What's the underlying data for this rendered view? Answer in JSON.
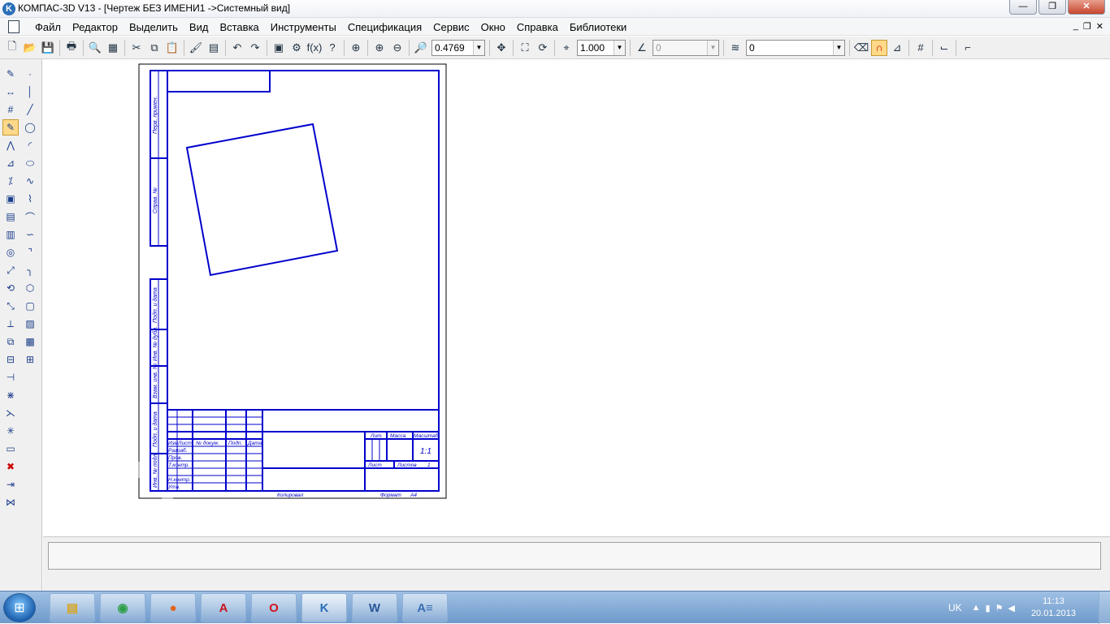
{
  "window": {
    "title": "КОМПАС-3D V13 - [Чертеж БЕЗ ИМЕНИ1 ->Системный вид]",
    "minimize": "—",
    "maximize": "❐",
    "close": "✕"
  },
  "menu": {
    "items": [
      "Файл",
      "Редактор",
      "Выделить",
      "Вид",
      "Вставка",
      "Инструменты",
      "Спецификация",
      "Сервис",
      "Окно",
      "Справка",
      "Библиотеки"
    ],
    "mdi_min": "_",
    "mdi_restore": "❐",
    "mdi_close": "✕"
  },
  "toolbar": {
    "zoom_value": "0.4769",
    "step_value": "1.000",
    "angle_value": "0",
    "layer_value": "0"
  },
  "drawing": {
    "title_block": {
      "col_izm": "Изм",
      "col_list": "Лист",
      "col_doc": "№ докум.",
      "col_podp": "Подп.",
      "col_data": "Дата",
      "razrab": "Разраб.",
      "prov": "Пров.",
      "tkontr": "Т.контр.",
      "nkontr": "Н.контр.",
      "utv": "Утв.",
      "lit": "Лит.",
      "massa": "Масса",
      "masshtab": "Масштаб",
      "scale_val": "1:1",
      "sheet": "Лист",
      "sheets": "Листов",
      "sheets_val": "1",
      "copied": "Копировал",
      "format": "Формат",
      "format_val": "A4"
    },
    "side_labels": [
      "Перв. примен.",
      "Справ. №",
      "Подп. и дата",
      "Инв. № дубл.",
      "Взам. инв. №",
      "Подп. и дата",
      "Инв. № подл."
    ]
  },
  "taskbar": {
    "start": "⊞",
    "apps": [
      {
        "name": "explorer",
        "glyph": "▤",
        "color": "#d9a520"
      },
      {
        "name": "chrome",
        "glyph": "◉",
        "color": "#2e9e48"
      },
      {
        "name": "firefox",
        "glyph": "●",
        "color": "#e2661c"
      },
      {
        "name": "acrobat",
        "glyph": "A",
        "color": "#c8161e"
      },
      {
        "name": "opera",
        "glyph": "O",
        "color": "#d4141d"
      },
      {
        "name": "kompas",
        "glyph": "K",
        "color": "#2a6fb8"
      },
      {
        "name": "word",
        "glyph": "W",
        "color": "#2b579a"
      },
      {
        "name": "notepad",
        "glyph": "A≡",
        "color": "#3a6eb5"
      }
    ],
    "lang": "UK",
    "time": "11:13",
    "date": "20.01.2013"
  },
  "colors": {
    "drawing_line": "#0000cc",
    "accent": "#2a6fb8"
  }
}
